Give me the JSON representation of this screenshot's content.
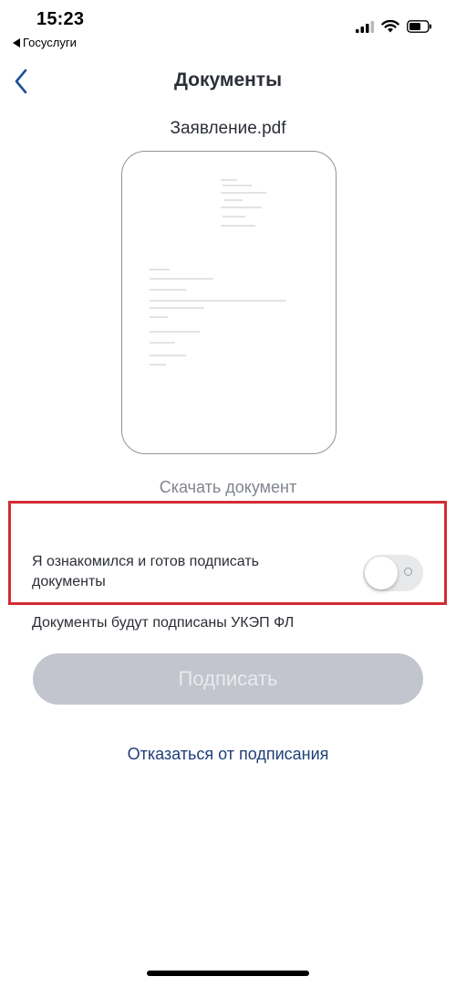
{
  "status_bar": {
    "time": "15:23",
    "back_app": "Госуслуги",
    "icons": [
      "signal-icon",
      "wifi-icon",
      "battery-icon"
    ]
  },
  "nav": {
    "back_icon": "chevron-left-icon",
    "title": "Документы"
  },
  "document": {
    "file_name": "Заявление.pdf",
    "download_label": "Скачать документ"
  },
  "consent": {
    "label": "Я ознакомился и готов подписать документы",
    "toggle_on": false
  },
  "signature": {
    "note": "Документы будут подписаны УКЭП ФЛ",
    "sign_button": "Подписать",
    "decline_link": "Отказаться от подписания"
  },
  "colors": {
    "accent_link": "#1f3f77",
    "disabled_button": "#c2c5cd",
    "highlight_border": "#d42b34",
    "back_chevron": "#1d4f9c"
  }
}
